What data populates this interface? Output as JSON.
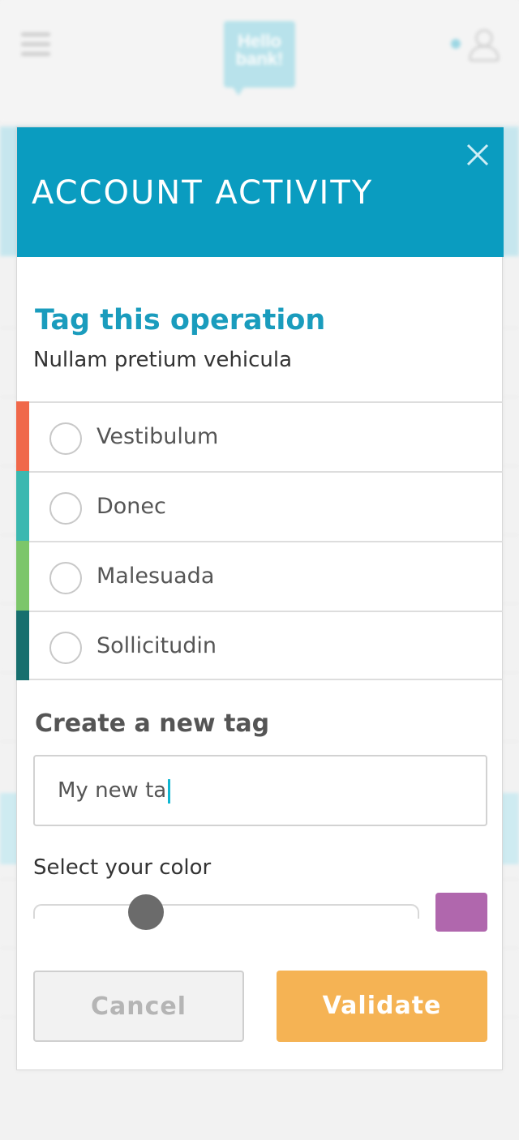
{
  "background": {
    "logo_text": "Hello bank!"
  },
  "modal": {
    "title": "ACCOUNT ACTIVITY",
    "section_title": "Tag this operation",
    "operation_name": "Nullam pretium vehicula",
    "tags": [
      {
        "label": "Vestibulum",
        "color": "#f0684a"
      },
      {
        "label": "Donec",
        "color": "#3bb8b0"
      },
      {
        "label": "Malesuada",
        "color": "#7cc66a"
      },
      {
        "label": "Sollicitudin",
        "color": "#176f6e"
      }
    ],
    "create_title": "Create a new tag",
    "new_tag_value": "My new ta",
    "color_label": "Select your color",
    "selected_color": "#b067ad",
    "slider_value": 0.3,
    "cancel_label": "Cancel",
    "validate_label": "Validate"
  },
  "colors": {
    "header": "#0a9cc0",
    "accent_title": "#1a9cbd",
    "validate": "#f5b354"
  }
}
